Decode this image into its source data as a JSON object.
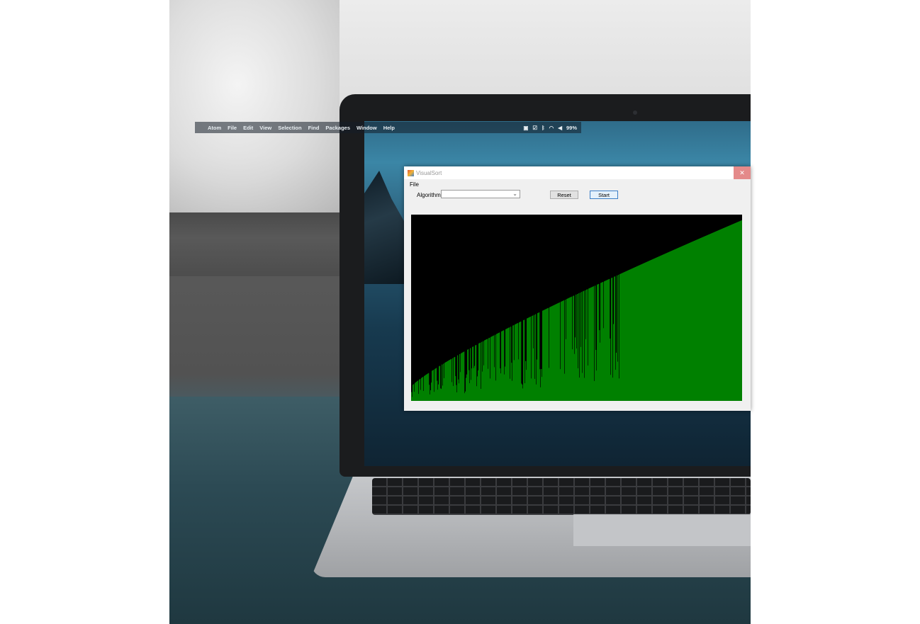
{
  "mac_menubar": {
    "apple_icon": "apple-icon",
    "items": [
      "Atom",
      "File",
      "Edit",
      "View",
      "Selection",
      "Find",
      "Packages",
      "Window",
      "Help"
    ],
    "battery": "99%"
  },
  "visualsort": {
    "title": "VisualSort",
    "menu": {
      "file": "File"
    },
    "algorithm_label": "Algorithm",
    "algorithm_value": "",
    "reset_label": "Reset",
    "start_label": "Start"
  },
  "colors": {
    "bars": "#008000",
    "canvas": "#000000",
    "close_hover": "#e48a8a"
  },
  "visualization": {
    "type": "bar",
    "bar_count": 467,
    "sorted_fraction": 0.63,
    "value_range": [
      0,
      100
    ]
  }
}
